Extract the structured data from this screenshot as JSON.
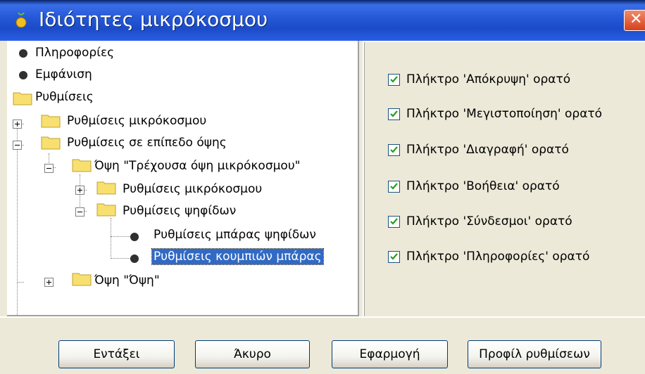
{
  "window": {
    "title": "Ιδιότητες μικρόκοσμου"
  },
  "tree": {
    "items": [
      {
        "label": "Πληροφορίες"
      },
      {
        "label": "Εμφάνιση"
      },
      {
        "label": "Ρυθμίσεις"
      },
      {
        "label": "Ρυθμίσεις μικρόκοσμου"
      },
      {
        "label": "Ρυθμίσεις σε επίπεδο όψης"
      },
      {
        "label": "Όψη \"Τρέχουσα όψη μικρόκοσμου\""
      },
      {
        "label": "Ρυθμίσεις μικρόκοσμου"
      },
      {
        "label": "Ρυθμίσεις ψηφίδων"
      },
      {
        "label": "Ρυθμίσεις μπάρας ψηφίδων"
      },
      {
        "label": "Ρυθμίσεις κουμπιών μπάρας"
      },
      {
        "label": "Όψη \"Όψη\""
      }
    ],
    "selected_index": 9
  },
  "options": [
    {
      "label": "Πλήκτρο 'Απόκρυψη' ορατό",
      "checked": true
    },
    {
      "label": "Πλήκτρο 'Μεγιστοποίηση' ορατό",
      "checked": true
    },
    {
      "label": "Πλήκτρο 'Διαγραφή' ορατό",
      "checked": true
    },
    {
      "label": "Πλήκτρο 'Βοήθεια' ορατό",
      "checked": true
    },
    {
      "label": "Πλήκτρο 'Σύνδεσμοι' ορατό",
      "checked": true
    },
    {
      "label": "Πλήκτρο 'Πληροφορίες' ορατό",
      "checked": true
    }
  ],
  "buttons": {
    "ok": "Εντάξει",
    "cancel": "Άκυρο",
    "apply": "Εφαρμογή",
    "profile": "Προφίλ ρυθμίσεων"
  },
  "colors": {
    "titlebar": "#2457d6",
    "selection": "#316ac5",
    "checkmark": "#21a121",
    "close": "#d6401e"
  }
}
